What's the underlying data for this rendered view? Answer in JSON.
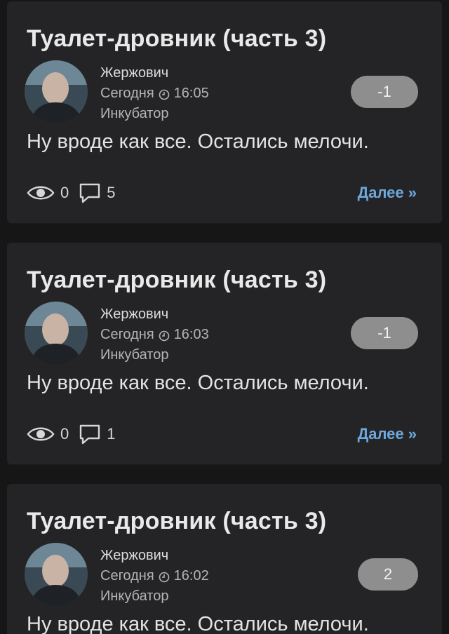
{
  "posts": [
    {
      "title": "Туалет-дровник (часть 3)",
      "author": "Жержович",
      "date": "Сегодня",
      "time": "16:05",
      "community": "Инкубатор",
      "rating": "-1",
      "body": "Ну вроде как все. Остались мелочи.",
      "views": "0",
      "comments": "5",
      "more_label": "Далее »"
    },
    {
      "title": "Туалет-дровник (часть 3)",
      "author": "Жержович",
      "date": "Сегодня",
      "time": "16:03",
      "community": "Инкубатор",
      "rating": "-1",
      "body": "Ну вроде как все. Остались мелочи.",
      "views": "0",
      "comments": "1",
      "more_label": "Далее »"
    },
    {
      "title": "Туалет-дровник (часть 3)",
      "author": "Жержович",
      "date": "Сегодня",
      "time": "16:02",
      "community": "Инкубатор",
      "rating": "2",
      "body": "Ну вроде как все. Остались мелочи."
    }
  ],
  "icons": {
    "views": "eye-icon",
    "comments": "comment-bubble-icon",
    "time": "clock-icon"
  },
  "colors": {
    "background": "#161616",
    "card": "#242426",
    "rating_badge": "#8e8e8e",
    "link": "#6ea8dc"
  }
}
